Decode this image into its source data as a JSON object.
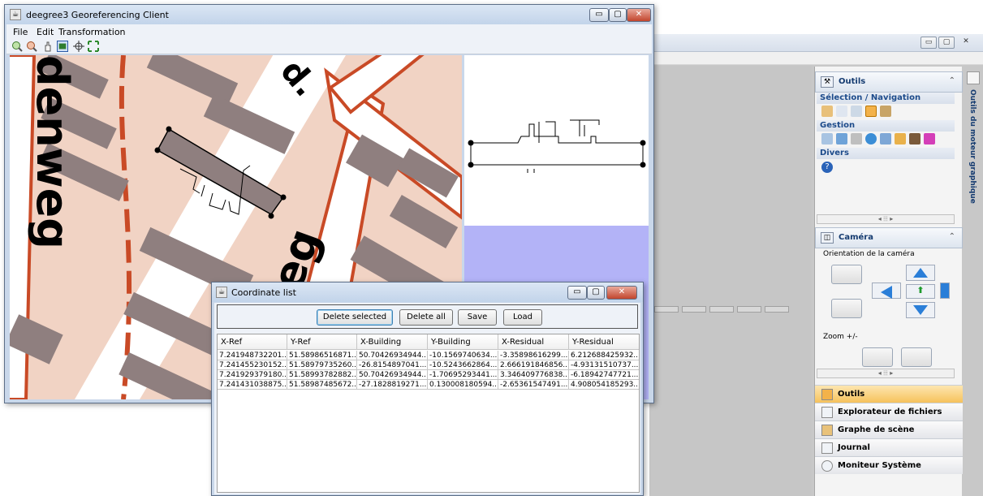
{
  "background_window": {
    "controls": [
      "▭",
      "▢",
      "✕"
    ],
    "dock": {
      "outils_panel": {
        "title": "Outils",
        "sections": [
          "Sélection / Navigation",
          "Gestion",
          "Divers"
        ]
      },
      "camera_panel": {
        "title": "Caméra",
        "orientation_label": "Orientation de la caméra",
        "zoom_label": "Zoom +/-"
      },
      "nav_items": [
        "Outils",
        "Explorateur de fichiers",
        "Graphe de scène",
        "Journal",
        "Moniteur Système"
      ],
      "vertical_tab": "Outils du moteur graphique"
    }
  },
  "main_window": {
    "title": "deegree3 Georeferencing Client",
    "menu": [
      "File",
      "Edit",
      "Transformation"
    ],
    "controls": [
      "▭",
      "▢",
      "✕"
    ],
    "map_labels": [
      "denweg",
      "weg"
    ],
    "colors": {
      "road": "#c94a26",
      "building": "#8f7f7f",
      "land": "#f1d3c4",
      "water": "#b3b3f7"
    }
  },
  "coordinate_list": {
    "title": "Coordinate list",
    "buttons": {
      "delete_selected": "Delete selected",
      "delete_all": "Delete all",
      "save": "Save",
      "load": "Load"
    },
    "columns": [
      "X-Ref",
      "Y-Ref",
      "X-Building",
      "Y-Building",
      "X-Residual",
      "Y-Residual"
    ],
    "rows": [
      [
        "7.241948732201...",
        "51.58986516871...",
        "50.70426934944...",
        "-10.1569740634...",
        "-3.35898616299...",
        "6.212688425932..."
      ],
      [
        "7.241455230152...",
        "51.58979735260...",
        "-26.8154897041...",
        "-10.5243662864...",
        "2.666191846856...",
        "-4.93131510737..."
      ],
      [
        "7.241929379180...",
        "51.58993782882...",
        "50.70426934944...",
        "-1.70695293441...",
        "3.346409776838...",
        "-6.18942747721..."
      ],
      [
        "7.241431038875...",
        "51.58987485672...",
        "-27.1828819271...",
        "0.130008180594...",
        "-2.65361547491...",
        "4.908054185293..."
      ]
    ]
  }
}
